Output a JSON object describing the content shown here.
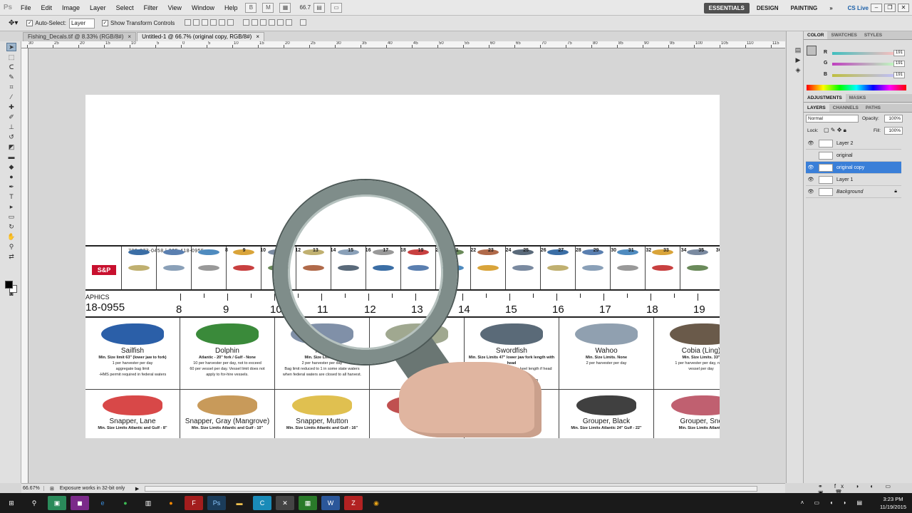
{
  "app": {
    "logo": "Ps"
  },
  "menu": [
    "File",
    "Edit",
    "Image",
    "Layer",
    "Select",
    "Filter",
    "View",
    "Window",
    "Help"
  ],
  "zoom_value": "66.7",
  "workspaces": {
    "essentials": "ESSENTIALS",
    "design": "DESIGN",
    "painting": "PAINTING",
    "more": "»",
    "cslive": "CS Live"
  },
  "options": {
    "autoselect_label": "Auto-Select:",
    "autoselect_value": "Layer",
    "transform_label": "Show Transform Controls"
  },
  "tabs": [
    {
      "label": "Fishing_Decals.tif @ 8.33% (RGB/8#)",
      "close": "×"
    },
    {
      "label": "Untitled-1 @ 66.7% (original copy, RGB/8#)",
      "close": "×"
    }
  ],
  "hruler_numbers": [
    "30",
    "25",
    "20",
    "15",
    "10",
    "5",
    "0",
    "5",
    "10",
    "15",
    "20",
    "25",
    "30",
    "35",
    "40",
    "45",
    "50",
    "55",
    "60",
    "65",
    "70",
    "75",
    "80",
    "85",
    "90",
    "95",
    "100",
    "105",
    "110",
    "115",
    "120"
  ],
  "strip": {
    "phone": "786-873-0458  |  305-418-0955",
    "logo": "S&P",
    "numbers": [
      "8",
      "9",
      "10",
      "11",
      "12",
      "13",
      "14",
      "15",
      "16",
      "17",
      "18",
      "19",
      "20",
      "21",
      "22",
      "23",
      "24",
      "25",
      "26",
      "27",
      "28",
      "29",
      "30",
      "31",
      "32",
      "33",
      "34",
      "35",
      "36"
    ]
  },
  "ruler": {
    "brand": "APHICS",
    "phone": "18-0955",
    "numbers": [
      "8",
      "9",
      "10",
      "11",
      "12",
      "13",
      "14",
      "15",
      "16",
      "17",
      "18",
      "19"
    ]
  },
  "fish_row1": [
    {
      "name": "Sailfish",
      "r1": "Min. Size limit 63\" (lower jaw to fork)",
      "r2": "1 per harvester per day",
      "r3": "aggregate bag limit",
      "r4": "-HMS permit required in federal waters"
    },
    {
      "name": "Dolphin",
      "r1": "Atlantic - 20\" fork / Gulf - None",
      "r2": "10 per harvester per day, not to exceed",
      "r3": "60 per vessel per day. Vessel limit does not",
      "r4": "apply to for-hire vessels."
    },
    {
      "name": "Mac",
      "r1": "Min. Size Limits 24",
      "r2": "2 per harvester per day",
      "r3": "Bag limit reduced to 1 in some state waters",
      "r4": "when federal waters are closed to all harvest."
    },
    {
      "name": "nish",
      "r1": "",
      "r2": "",
      "r3": "",
      "r4": ""
    },
    {
      "name": "Swordfish",
      "r1": "Min. Size Limits 47\" lower jaw fork length with head",
      "r2": "attached or 25\" cleithrum to keel length if head",
      "r3": "removed",
      "r4": "day, not to exceed a maximum"
    },
    {
      "name": "Wahoo",
      "r1": "Min. Size Limits. None",
      "r2": "2 per harvester per day",
      "r3": "",
      "r4": ""
    },
    {
      "name": "Cobia (Ling)",
      "r1": "Min. Size Limits. 33\"",
      "r2": "1 per harvester per day, not to",
      "r3": "vessel per day",
      "r4": ""
    }
  ],
  "fish_row2": [
    {
      "name": "Snapper, Lane",
      "r1": "Min. Size Limits Atlantic and Gulf - 8\""
    },
    {
      "name": "Snapper, Gray (Mangrove)",
      "r1": "Min. Size Limits Atlantic and Gulf - 10\""
    },
    {
      "name": "Snapper, Mutton",
      "r1": "Min. Size Limits Atlantic and Gulf - 16\""
    },
    {
      "name": "Sna",
      "r1": ""
    },
    {
      "name": "",
      "r1": ""
    },
    {
      "name": "Grouper, Black",
      "r1": "Min. Size Limits Atlantic 24\" Gulf - 22\""
    },
    {
      "name": "Grouper, Snc",
      "r1": "Min. Size Limits Atlantic"
    }
  ],
  "color_panel": {
    "tabs": [
      "COLOR",
      "SWATCHES",
      "STYLES"
    ],
    "r": "191",
    "g": "191",
    "b": "191",
    "r_label": "R",
    "g_label": "G",
    "b_label": "B"
  },
  "adj_tabs": [
    "ADJUSTMENTS",
    "MASKS"
  ],
  "layer_tabs": [
    "LAYERS",
    "CHANNELS",
    "PATHS"
  ],
  "blend": "Normal",
  "opacity_label": "Opacity:",
  "opacity": "100%",
  "lock_label": "Lock:",
  "fill_label": "Fill:",
  "fill": "100%",
  "layers": [
    {
      "name": "Layer 2"
    },
    {
      "name": "original"
    },
    {
      "name": "original copy"
    },
    {
      "name": "Layer 1"
    },
    {
      "name": "Background"
    }
  ],
  "status": {
    "zoom": "66.67%",
    "msg": "Exposure works in 32-bit only"
  },
  "clock": {
    "time": "3:23 PM",
    "date": "11/19/2015"
  }
}
